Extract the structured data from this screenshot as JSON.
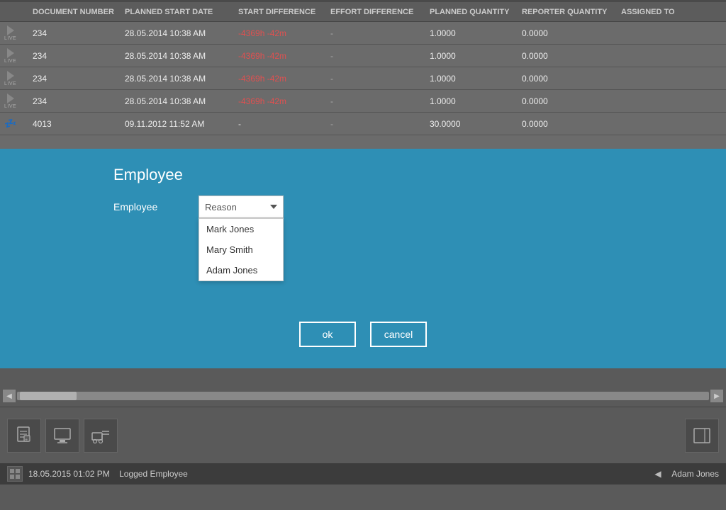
{
  "window": {
    "title": "Employee"
  },
  "table": {
    "headers": [
      "",
      "DOCUMENT NUMBER",
      "PLANNED START DATE",
      "START DIFFERENCE",
      "EFFORT DIFFERENCE",
      "PLANNED QUANTITY",
      "REPORTER QUANTITY",
      "ASSIGNED TO"
    ],
    "rows": [
      {
        "icon": "live",
        "doc": "234",
        "planStart": "28.05.2014 10:38 AM",
        "startDiff": "-4369h -42m",
        "effortDiff": "-",
        "planQty": "1.0000",
        "reportQty": "0.0000"
      },
      {
        "icon": "live",
        "doc": "234",
        "planStart": "28.05.2014 10:38 AM",
        "startDiff": "-4369h -42m",
        "effortDiff": "-",
        "planQty": "1.0000",
        "reportQty": "0.0000"
      },
      {
        "icon": "live",
        "doc": "234",
        "planStart": "28.05.2014 10:38 AM",
        "startDiff": "-4369h -42m",
        "effortDiff": "-",
        "planQty": "1.0000",
        "reportQty": "0.0000"
      },
      {
        "icon": "live",
        "doc": "234",
        "planStart": "28.05.2014 10:38 AM",
        "startDiff": "-4369h -42m",
        "effortDiff": "-",
        "planQty": "1.0000",
        "reportQty": "0.0000"
      },
      {
        "icon": "sleep",
        "doc": "4013",
        "planStart": "09.11.2012 11:52 AM",
        "startDiff": "-",
        "effortDiff": "-",
        "planQty": "30.0000",
        "reportQty": "0.0000"
      }
    ]
  },
  "dialog": {
    "title": "Employee",
    "label": "Employee",
    "dropdown": {
      "placeholder": "Reason",
      "options": [
        "Mark Jones",
        "Mary Smith",
        "Adam Jones"
      ]
    },
    "buttons": {
      "ok": "ok",
      "cancel": "cancel"
    }
  },
  "statusBar": {
    "timestamp": "18.05.2015 01:02 PM",
    "loggedLabel": "Logged Employee",
    "user": "Adam Jones"
  }
}
